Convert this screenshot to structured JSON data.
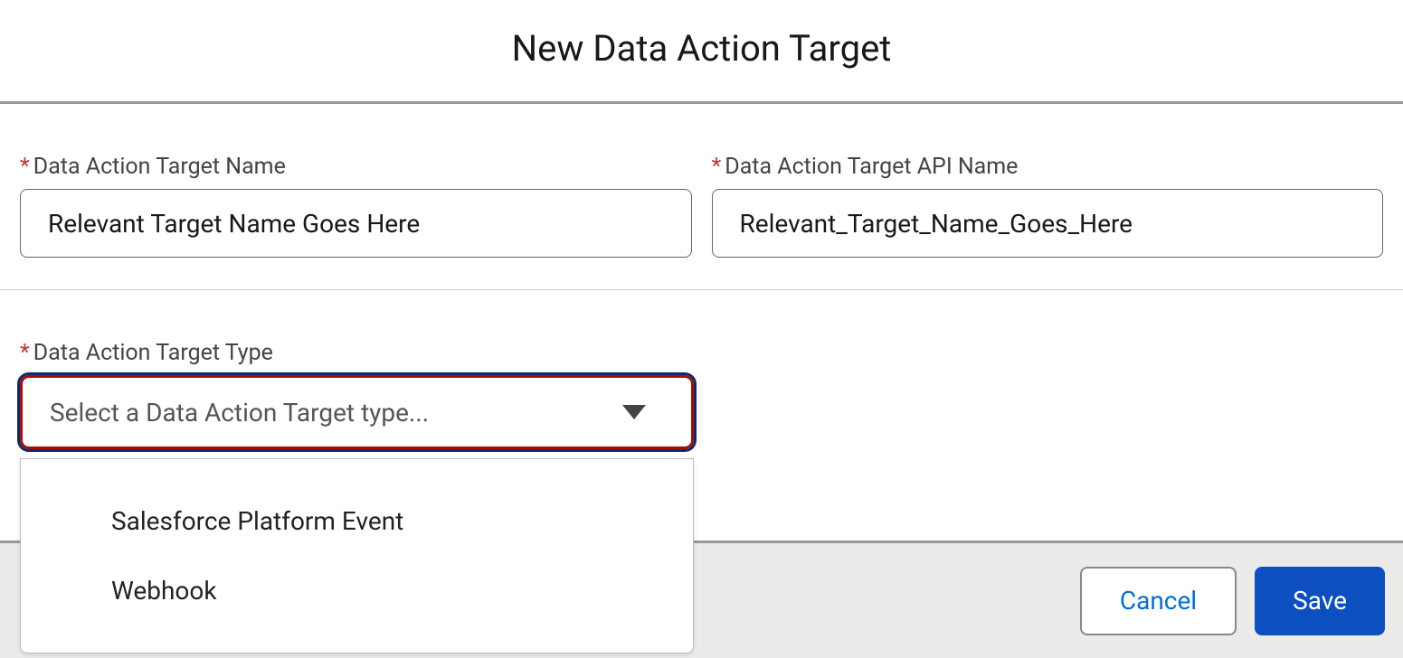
{
  "header": {
    "title": "New Data Action Target"
  },
  "fields": {
    "name": {
      "label": "Data Action Target Name",
      "value": "Relevant Target Name Goes Here"
    },
    "api_name": {
      "label": "Data Action Target API Name",
      "value": "Relevant_Target_Name_Goes_Here"
    },
    "type": {
      "label": "Data Action Target Type",
      "placeholder": "Select a Data Action Target type...",
      "options": [
        "Salesforce Platform Event",
        "Webhook"
      ]
    }
  },
  "footer": {
    "cancel": "Cancel",
    "save": "Save"
  }
}
